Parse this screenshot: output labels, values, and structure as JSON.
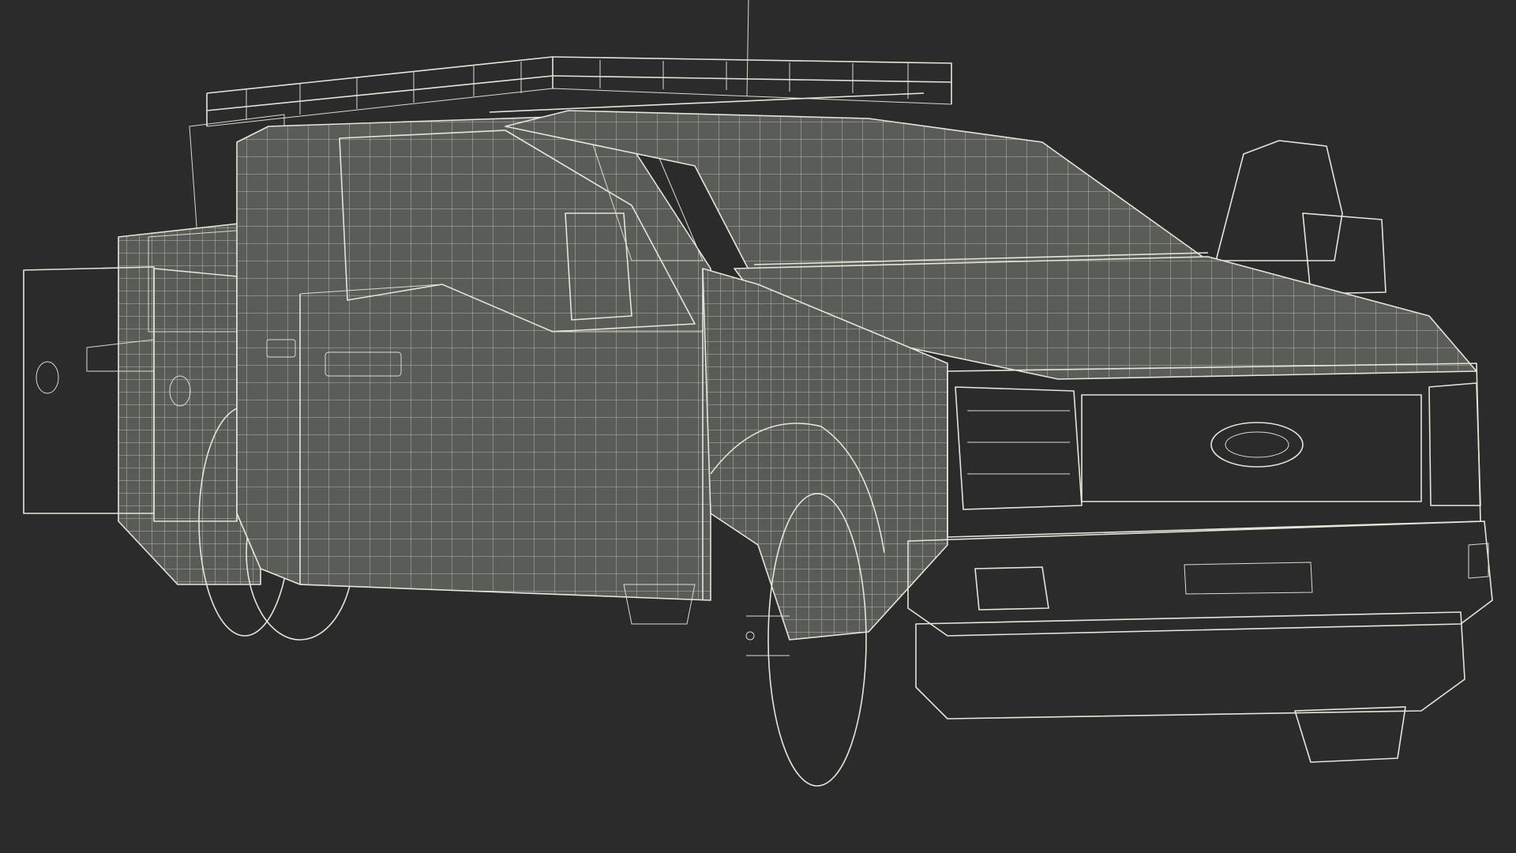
{
  "scene": {
    "subject": "",
    "background_color": "#2b2b2b",
    "mesh_color": "#595b56",
    "wire_color": "#d9dccf"
  }
}
